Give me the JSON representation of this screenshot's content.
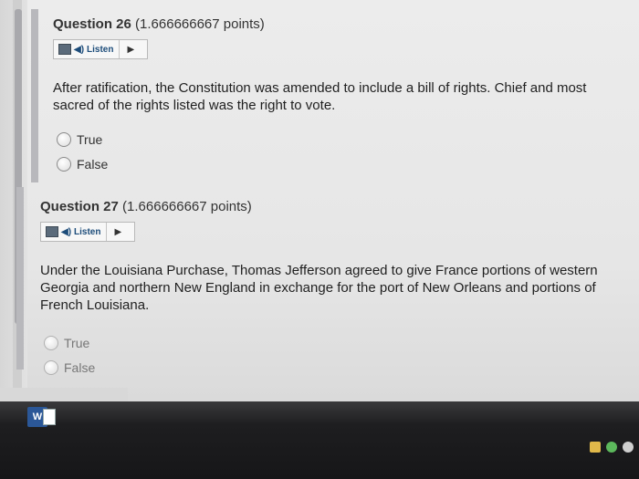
{
  "questions": [
    {
      "title": "Question 26",
      "points": "(1.666666667 points)",
      "listen_label": "Listen",
      "text": "After ratification, the Constitution was amended to include a bill of rights.  Chief and most sacred of the rights listed was the right to vote.",
      "options": [
        "True",
        "False"
      ]
    },
    {
      "title": "Question 27",
      "points": "(1.666666667 points)",
      "listen_label": "Listen",
      "text": "Under the Louisiana Purchase, Thomas Jefferson agreed to give France portions of western Georgia and northern New England in exchange for the port of New Orleans and portions of French Louisiana.",
      "options": [
        "True",
        "False"
      ]
    }
  ],
  "taskbar": {
    "word_icon_letter": "W"
  },
  "icons": {
    "speaker": "speaker-icon",
    "play": "play-icon",
    "document": "document-icon",
    "word": "word-app-icon"
  }
}
